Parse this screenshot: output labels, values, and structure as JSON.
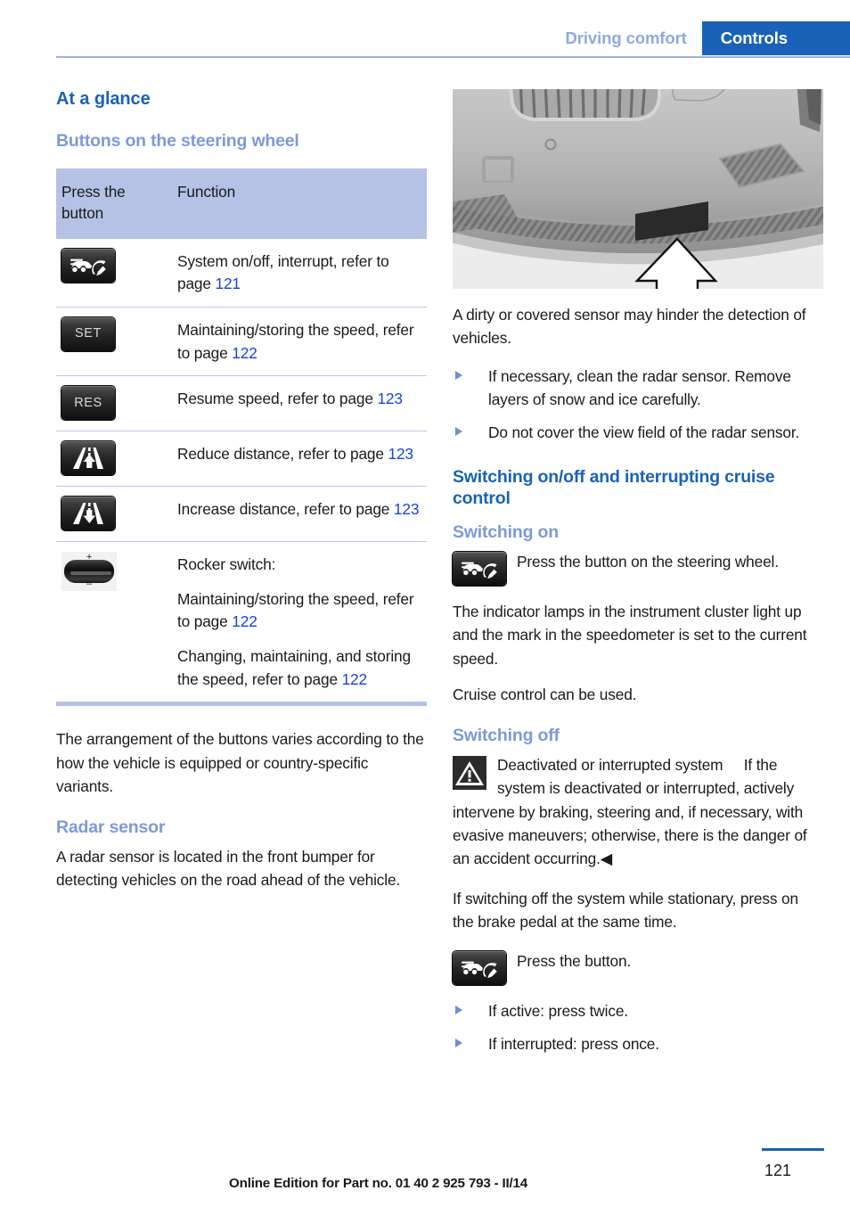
{
  "header": {
    "secondary_tab": "Driving comfort",
    "primary_tab": "Controls"
  },
  "left_column": {
    "heading_main": "At a glance",
    "heading_sub": "Buttons on the steering wheel",
    "table": {
      "columns": [
        "Press the button",
        "Function"
      ],
      "rows": [
        {
          "icon": "cruise-control-car-icon",
          "icon_label": "",
          "lines": [
            {
              "text": "System on/off, interrupt, refer to page ",
              "xref": "121"
            }
          ]
        },
        {
          "icon": "set-button-icon",
          "icon_label": "SET",
          "lines": [
            {
              "text": "Maintaining/storing the speed, refer to page ",
              "xref": "122"
            }
          ]
        },
        {
          "icon": "res-button-icon",
          "icon_label": "RES",
          "lines": [
            {
              "text": "Resume speed, refer to page ",
              "xref": "123"
            }
          ]
        },
        {
          "icon": "reduce-distance-icon",
          "icon_label": "",
          "lines": [
            {
              "text": "Reduce distance, refer to page ",
              "xref": "123"
            }
          ]
        },
        {
          "icon": "increase-distance-icon",
          "icon_label": "",
          "lines": [
            {
              "text": "Increase distance, refer to page ",
              "xref": "123"
            }
          ]
        },
        {
          "icon": "rocker-switch-icon",
          "icon_label": "",
          "lines": [
            {
              "text": "Rocker switch:",
              "xref": ""
            },
            {
              "text": "Maintaining/storing the speed, refer to page ",
              "xref": "122"
            },
            {
              "text": "Changing, maintaining, and storing the speed, refer to page ",
              "xref": "122"
            }
          ]
        }
      ]
    },
    "note_paragraph": "The arrangement of the buttons varies according to the how the vehicle is equipped or country-specific variants.",
    "radar_heading": "Radar sensor",
    "radar_paragraph": "A radar sensor is located in the front bumper for detecting vehicles on the road ahead of the vehicle."
  },
  "right_column": {
    "figure_caption": "",
    "sensor_paragraph": "A dirty or covered sensor may hinder the detection of vehicles.",
    "sensor_bullets": [
      "If necessary, clean the radar sensor. Remove layers of snow and ice carefully.",
      "Do not cover the view field of the radar sensor."
    ],
    "switching_heading": "Switching on/off and interrupting cruise control",
    "switching_on_heading": "Switching on",
    "switching_on_icon_text": "Press the button on the steering wheel.",
    "switching_on_para_1": "The indicator lamps in the instrument cluster light up and the mark in the speedometer is set to the current speed.",
    "switching_on_para_2": "Cruise control can be used.",
    "switching_off_heading": "Switching off",
    "warning_title": "Deactivated or interrupted system",
    "warning_body": "If the system is deactivated or interrupted, actively intervene by braking, steering and, if necessary, with evasive maneuvers; otherwise, there is the danger of an accident occurring.◀",
    "stationary_paragraph": "If switching off the system while stationary, press on the brake pedal at the same time.",
    "press_button_text": "Press the button.",
    "press_bullets": [
      "If active: press twice.",
      "If interrupted: press once."
    ]
  },
  "footer": {
    "page_number": "121",
    "edition": "Online Edition for Part no. 01 40 2 925 793 - II/14"
  },
  "colors": {
    "brand_blue": "#1a62b8",
    "light_blue": "#7d9ad8",
    "table_header_bg": "#b5c2e5",
    "xref_blue": "#1a3fe0"
  }
}
